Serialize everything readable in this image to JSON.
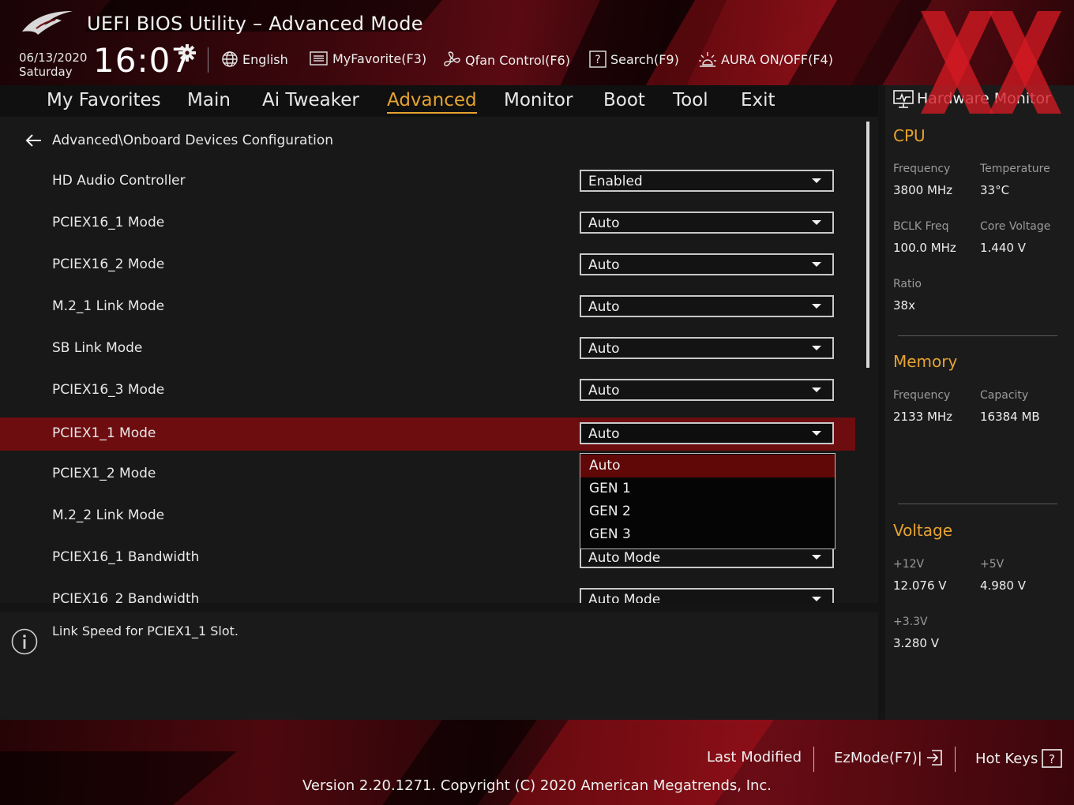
{
  "header": {
    "title": "UEFI BIOS Utility – Advanced Mode",
    "date": "06/13/2020",
    "day": "Saturday",
    "time": "16:07",
    "tools": [
      {
        "label": "English",
        "icon": "globe-icon"
      },
      {
        "label": "MyFavorite(F3)",
        "icon": "list-icon"
      },
      {
        "label": "Qfan Control(F6)",
        "icon": "fan-icon"
      },
      {
        "label": "Search(F9)",
        "icon": "question-box-icon"
      },
      {
        "label": "AURA ON/OFF(F4)",
        "icon": "aura-light-icon"
      }
    ]
  },
  "nav": {
    "tabs": [
      "My Favorites",
      "Main",
      "Ai Tweaker",
      "Advanced",
      "Monitor",
      "Boot",
      "Tool",
      "Exit"
    ],
    "active": "Advanced"
  },
  "main": {
    "breadcrumb": "Advanced\\Onboard Devices Configuration",
    "rows": [
      {
        "label": "HD Audio Controller",
        "value": "Enabled"
      },
      {
        "label": "PCIEX16_1 Mode",
        "value": "Auto"
      },
      {
        "label": "PCIEX16_2 Mode",
        "value": "Auto"
      },
      {
        "label": "M.2_1 Link Mode",
        "value": "Auto"
      },
      {
        "label": "SB Link Mode",
        "value": "Auto"
      },
      {
        "label": "PCIEX16_3 Mode",
        "value": "Auto"
      },
      {
        "label": "PCIEX1_1 Mode",
        "value": "Auto"
      },
      {
        "label": "PCIEX1_2 Mode",
        "value": ""
      },
      {
        "label": "M.2_2 Link Mode",
        "value": ""
      },
      {
        "label": "PCIEX16_1 Bandwidth",
        "value": "Auto Mode"
      },
      {
        "label": "PCIEX16_2 Bandwidth",
        "value": "Auto Mode"
      }
    ],
    "selected_row": "PCIEX1_1 Mode",
    "dropdown_options": [
      "Auto",
      "GEN 1",
      "GEN 2",
      "GEN 3"
    ],
    "dropdown_highlighted": "Auto"
  },
  "help": {
    "text": "Link Speed for PCIEX1_1 Slot."
  },
  "hardware_monitor": {
    "title": "Hardware Monitor",
    "cpu": {
      "heading": "CPU",
      "frequency_label": "Frequency",
      "frequency": "3800 MHz",
      "temperature_label": "Temperature",
      "temperature": "33°C",
      "bclk_label": "BCLK Freq",
      "bclk": "100.0 MHz",
      "core_voltage_label": "Core Voltage",
      "core_voltage": "1.440 V",
      "ratio_label": "Ratio",
      "ratio": "38x"
    },
    "memory": {
      "heading": "Memory",
      "frequency_label": "Frequency",
      "frequency": "2133 MHz",
      "capacity_label": "Capacity",
      "capacity": "16384 MB"
    },
    "voltage": {
      "heading": "Voltage",
      "v12_label": "+12V",
      "v12": "12.076 V",
      "v5_label": "+5V",
      "v5": "4.980 V",
      "v33_label": "+3.3V",
      "v33": "3.280 V"
    }
  },
  "footer": {
    "last_modified": "Last Modified",
    "ezmode": "EzMode(F7)|",
    "hotkeys": "Hot Keys",
    "version": "Version 2.20.1271. Copyright (C) 2020 American Megatrends, Inc."
  },
  "colors": {
    "accent": "#e6a330",
    "selected_row": "#6e0d10",
    "dropdown_highlight": "#600707",
    "brand_red": "#c8141e"
  }
}
